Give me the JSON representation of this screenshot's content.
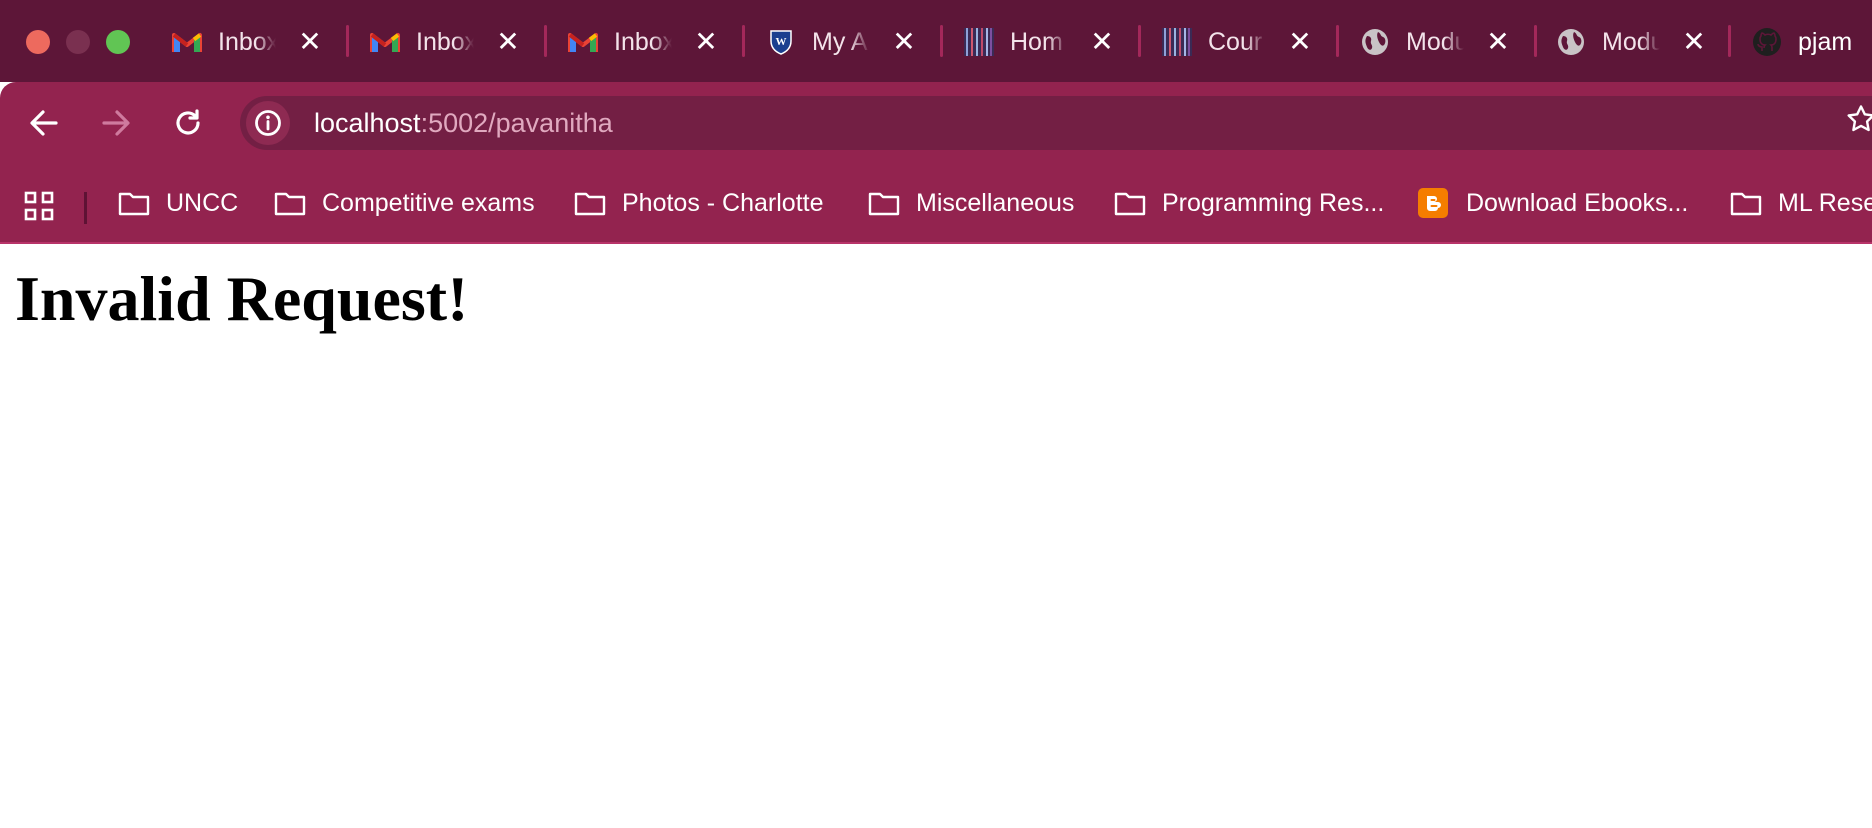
{
  "browser": {
    "theme_colors": {
      "tabbar": "#5d1638",
      "toolbar": "#93234f",
      "omnibox": "#731f44"
    },
    "tabs": [
      {
        "title": "Inbox",
        "icon": "gmail-icon"
      },
      {
        "title": "Inbox",
        "icon": "gmail-icon"
      },
      {
        "title": "Inbox",
        "icon": "gmail-icon"
      },
      {
        "title": "My A",
        "icon": "shield-crest-icon"
      },
      {
        "title": "Hom",
        "icon": "striped-thumbnail-icon"
      },
      {
        "title": "Cour",
        "icon": "striped-thumbnail-icon"
      },
      {
        "title": "Modu",
        "icon": "globe-icon"
      },
      {
        "title": "Modu",
        "icon": "globe-icon"
      },
      {
        "title": "pjam",
        "icon": "github-icon"
      }
    ],
    "address_bar": {
      "host": "localhost",
      "path": ":5002/pavanitha"
    },
    "bookmarks": [
      {
        "label": "UNCC",
        "icon": "folder-icon"
      },
      {
        "label": "Competitive exams",
        "icon": "folder-icon"
      },
      {
        "label": "Photos - Charlotte",
        "icon": "folder-icon"
      },
      {
        "label": "Miscellaneous",
        "icon": "folder-icon"
      },
      {
        "label": "Programming Res...",
        "icon": "folder-icon"
      },
      {
        "label": "Download Ebooks...",
        "icon": "blogger-icon"
      },
      {
        "label": "ML Rese",
        "icon": "folder-icon"
      }
    ]
  },
  "page": {
    "heading": "Invalid Request!"
  }
}
